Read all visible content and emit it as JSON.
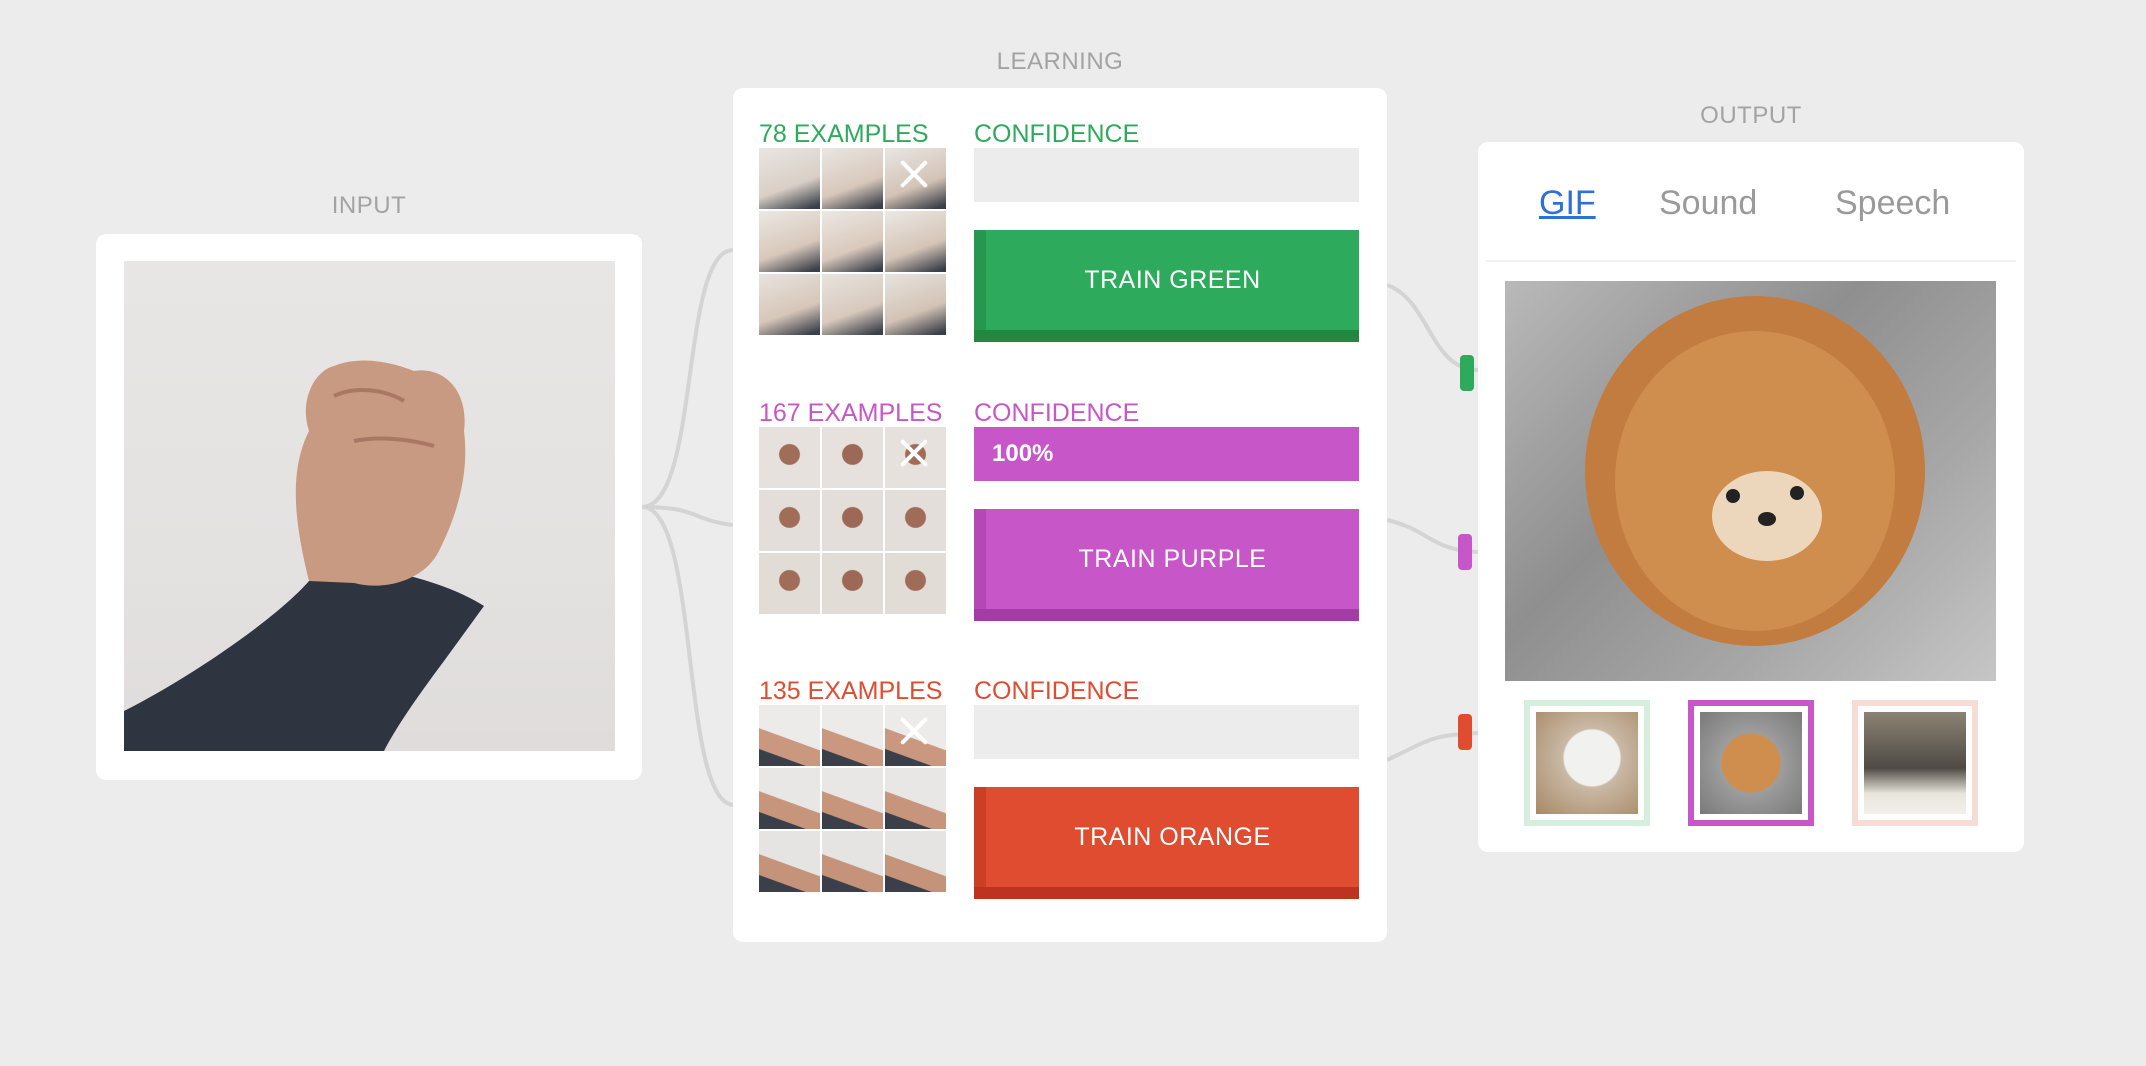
{
  "input": {
    "title": "INPUT"
  },
  "learning": {
    "title": "LEARNING",
    "rows": [
      {
        "examples": "78 EXAMPLES",
        "confidence_label": "CONFIDENCE",
        "confidence_value": 0,
        "confidence_text": "",
        "train_label": "TRAIN GREEN",
        "color": "#2eaa5c",
        "dark": "#22883f"
      },
      {
        "examples": "167 EXAMPLES",
        "confidence_label": "CONFIDENCE",
        "confidence_value": 1,
        "confidence_text": "100%",
        "train_label": "TRAIN PURPLE",
        "color": "#c756c8",
        "dark": "#a43ca5"
      },
      {
        "examples": "135 EXAMPLES",
        "confidence_label": "CONFIDENCE",
        "confidence_value": 0,
        "confidence_text": "",
        "train_label": "TRAIN ORANGE",
        "color": "#e04c30",
        "dark": "#bd3320"
      }
    ]
  },
  "output": {
    "title": "OUTPUT",
    "tabs": [
      "GIF",
      "Sound",
      "Speech"
    ],
    "active_tab": "GIF",
    "active_choice": 1
  },
  "colors": {
    "green": "#2eaa5c",
    "purple": "#c756c8",
    "orange": "#e04c30",
    "link": "#2f6fdc"
  }
}
